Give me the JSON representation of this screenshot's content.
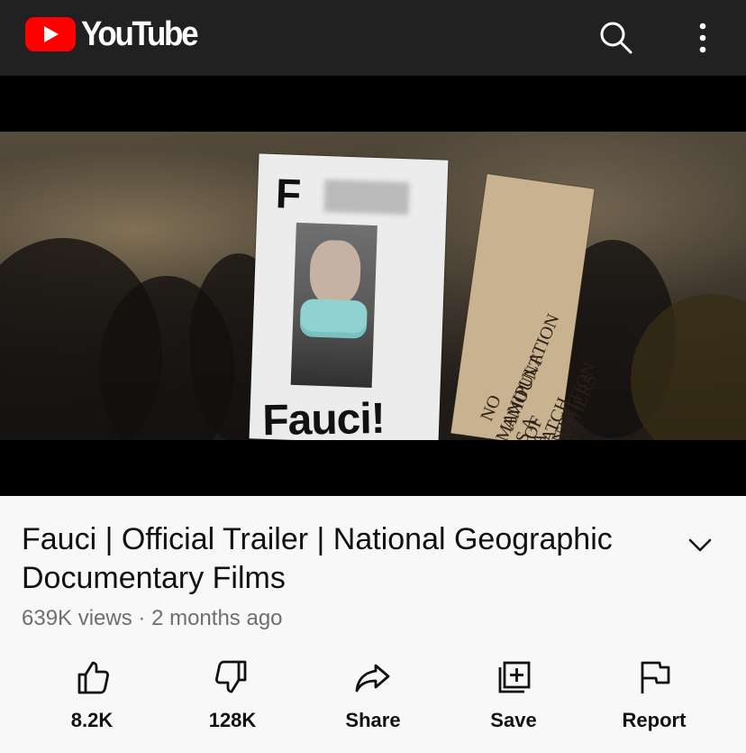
{
  "header": {
    "brand": "YouTube",
    "icons": {
      "logo": "youtube-play-icon",
      "search": "search-icon",
      "more": "more-vertical-icon"
    }
  },
  "video": {
    "title": "Fauci | Official Trailer | National Geographic Documentary Films",
    "views": "639K views",
    "separator": "·",
    "age": "2 months ago",
    "meta": "639K views · 2 months ago",
    "expand_icon": "chevron-down-icon",
    "thumbnail": {
      "left_sign": {
        "top_letter": "F",
        "bottom_text": "Fauci!"
      },
      "right_sign": {
        "lines": [
          "NO AMOUNT OF",
          "MANIPULATION",
          "IS A MATCH FOR",
          "A MOTHERS",
          "INTUITION"
        ]
      }
    }
  },
  "actions": [
    {
      "label": "8.2K",
      "icon": "thumbs-up-icon"
    },
    {
      "label": "128K",
      "icon": "thumbs-down-icon"
    },
    {
      "label": "Share",
      "icon": "share-icon"
    },
    {
      "label": "Save",
      "icon": "save-to-playlist-icon"
    },
    {
      "label": "Report",
      "icon": "report-flag-icon"
    }
  ],
  "colors": {
    "topbar": "#212121",
    "brand_red": "#ff0000",
    "background": "#f8f8f8",
    "title_text": "#111111",
    "meta_text": "#6f6f6f"
  }
}
